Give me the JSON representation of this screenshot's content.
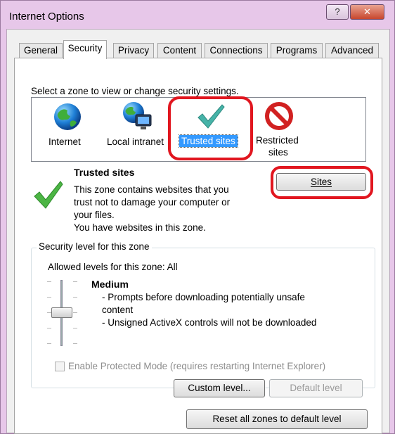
{
  "window": {
    "title": "Internet Options",
    "help_glyph": "?",
    "close_glyph": "✕"
  },
  "tabs": [
    {
      "label": "General"
    },
    {
      "label": "Security",
      "active": true
    },
    {
      "label": "Privacy"
    },
    {
      "label": "Content"
    },
    {
      "label": "Connections"
    },
    {
      "label": "Programs"
    },
    {
      "label": "Advanced"
    }
  ],
  "zones": {
    "prompt": "Select a zone to view or change security settings.",
    "items": [
      {
        "label": "Internet",
        "icon": "globe-icon"
      },
      {
        "label": "Local intranet",
        "icon": "intranet-icon"
      },
      {
        "label": "Trusted sites",
        "icon": "checkmark-icon",
        "selected": true
      },
      {
        "label_line1": "Restricted",
        "label_line2": "sites",
        "icon": "no-entry-icon"
      }
    ]
  },
  "zone_info": {
    "title": "Trusted sites",
    "lines": [
      "This zone contains websites that you",
      "trust not to damage your computer or",
      "your files.",
      "You have websites in this zone."
    ],
    "sites_button": "Sites"
  },
  "security_level": {
    "group_label": "Security level for this zone",
    "allowed": "Allowed levels for this zone: All",
    "level_name": "Medium",
    "bullets": [
      "- Prompts before downloading potentially unsafe",
      "content",
      "- Unsigned ActiveX controls will not be downloaded"
    ],
    "protected_mode_label": "Enable Protected Mode (requires restarting Internet Explorer)",
    "protected_mode_checked": false,
    "custom_level_button": "Custom level...",
    "default_level_button": "Default level",
    "reset_button": "Reset all zones to default level"
  },
  "colors": {
    "highlight_outline": "#e1161f",
    "selection_bg": "#3399ff",
    "check_green": "#3fae3a"
  }
}
